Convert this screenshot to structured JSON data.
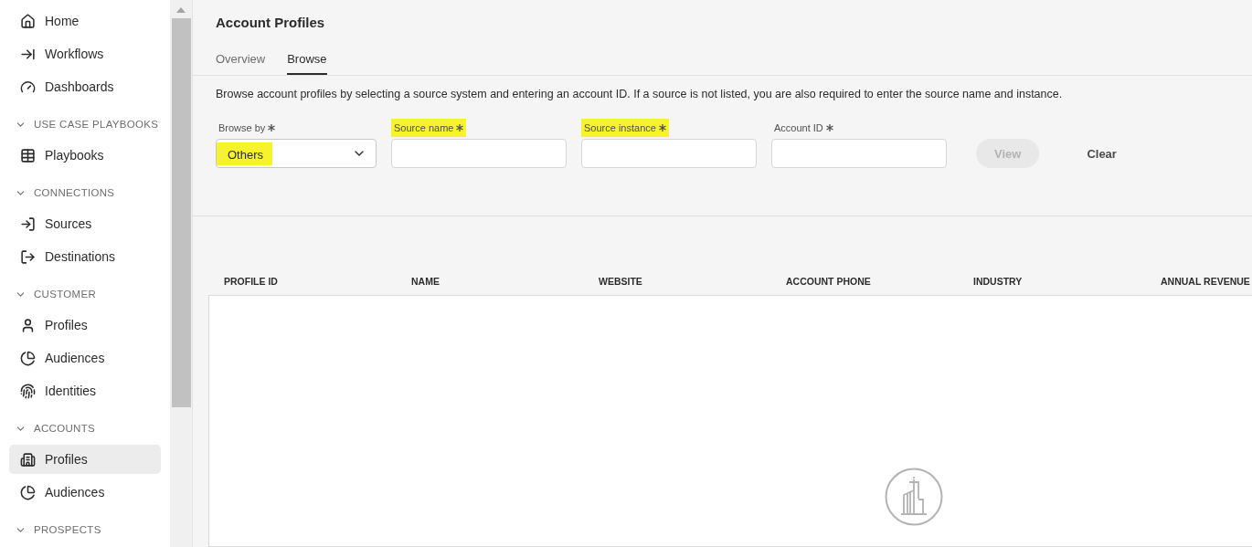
{
  "sidebar": {
    "items": [
      {
        "kind": "item",
        "label": "Home",
        "selected": false
      },
      {
        "kind": "item",
        "label": "Workflows",
        "selected": false
      },
      {
        "kind": "item",
        "label": "Dashboards",
        "selected": false
      },
      {
        "kind": "header",
        "label": "USE CASE PLAYBOOKS",
        "expanded": true
      },
      {
        "kind": "item",
        "label": "Playbooks",
        "selected": false
      },
      {
        "kind": "header",
        "label": "CONNECTIONS",
        "expanded": true
      },
      {
        "kind": "item",
        "label": "Sources",
        "selected": false
      },
      {
        "kind": "item",
        "label": "Destinations",
        "selected": false
      },
      {
        "kind": "header",
        "label": "CUSTOMER",
        "expanded": true
      },
      {
        "kind": "item",
        "label": "Profiles",
        "selected": false
      },
      {
        "kind": "item",
        "label": "Audiences",
        "selected": false
      },
      {
        "kind": "item",
        "label": "Identities",
        "selected": false
      },
      {
        "kind": "header",
        "label": "ACCOUNTS",
        "expanded": true
      },
      {
        "kind": "item",
        "label": "Profiles",
        "selected": true
      },
      {
        "kind": "item",
        "label": "Audiences",
        "selected": false
      },
      {
        "kind": "header",
        "label": "PROSPECTS",
        "expanded": true
      }
    ]
  },
  "page": {
    "title": "Account Profiles",
    "tabs": [
      {
        "label": "Overview",
        "selected": false
      },
      {
        "label": "Browse",
        "selected": true
      }
    ],
    "description": "Browse account profiles by selecting a source system and entering an account ID. If a source is not listed, you are also required to enter the source name and instance.",
    "form": {
      "fields": [
        {
          "kind": "select",
          "label": "Browse by",
          "required": true,
          "label_highlighted": false,
          "value": "Others",
          "value_highlighted": true
        },
        {
          "kind": "text",
          "label": "Source name",
          "required": true,
          "label_highlighted": true
        },
        {
          "kind": "text",
          "label": "Source instance",
          "required": true,
          "label_highlighted": true
        },
        {
          "kind": "text",
          "label": "Account ID",
          "required": true,
          "label_highlighted": false
        }
      ],
      "buttons": [
        {
          "label": "View",
          "kind": "filled",
          "disabled": true
        },
        {
          "label": "Clear",
          "kind": "quiet",
          "disabled": false
        }
      ]
    },
    "table": {
      "columns": [
        "PROFILE ID",
        "NAME",
        "WEBSITE",
        "ACCOUNT PHONE",
        "INDUSTRY",
        "ANNUAL REVENUE"
      ]
    }
  }
}
